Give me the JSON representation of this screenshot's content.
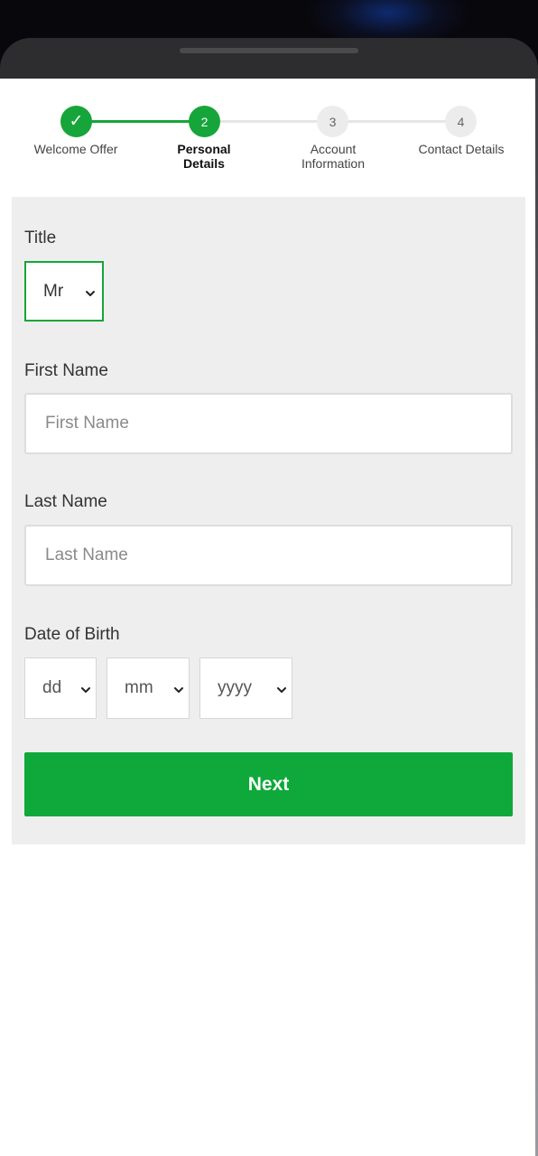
{
  "stepper": {
    "steps": [
      {
        "number": "✓",
        "label": "Welcome Offer",
        "state": "complete"
      },
      {
        "number": "2",
        "label": "Personal\nDetails",
        "state": "current"
      },
      {
        "number": "3",
        "label": "Account\nInformation",
        "state": "pending"
      },
      {
        "number": "4",
        "label": "Contact Details",
        "state": "pending"
      }
    ]
  },
  "form": {
    "title_label": "Title",
    "title_value": "Mr",
    "first_name_label": "First Name",
    "first_name_placeholder": "First Name",
    "last_name_label": "Last Name",
    "last_name_placeholder": "Last Name",
    "dob_label": "Date of Birth",
    "dob_day": "dd",
    "dob_month": "mm",
    "dob_year": "yyyy",
    "next_label": "Next"
  },
  "colors": {
    "accent": "#16a53a",
    "button": "#0ea93a",
    "panel": "#eeeeee"
  }
}
